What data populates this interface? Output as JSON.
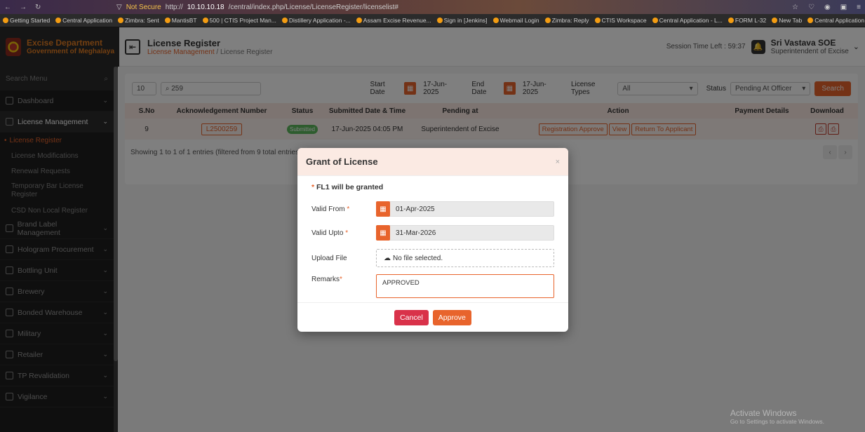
{
  "browser": {
    "not_secure": "Not Secure",
    "url_prefix": "http://",
    "url_host": "10.10.10.18",
    "url_path": "/central/index.php/License/LicenseRegister/licenselist#",
    "bookmarks": [
      "Getting Started",
      "Central Application",
      "Zimbra: Sent",
      "MantisBT",
      "500 | CTIS Project Man...",
      "Distillery Application -...",
      "Assam Excise Revenue...",
      "Sign in [Jenkins]",
      "Webmail Login",
      "Zimbra: Reply",
      "CTIS Workspace",
      "Central Application - L...",
      "FORM L-32",
      "New Tab",
      "Central Application -..."
    ]
  },
  "header": {
    "dept": "Excise Department",
    "gov": "Government of Meghalaya",
    "page_title": "License Register",
    "crumb_parent": "License Management",
    "crumb_sep": " / ",
    "crumb_current": "License Register",
    "session": "Session Time Left : 59:37",
    "user_name": "Sri Vastava SOE",
    "user_role": "Superintendent of Excise"
  },
  "sidebar": {
    "search_placeholder": "Search Menu",
    "items": [
      {
        "label": "Dashboard"
      },
      {
        "label": "License Management"
      },
      {
        "label": "Brand Label Management"
      },
      {
        "label": "Hologram Procurement"
      },
      {
        "label": "Bottling Unit"
      },
      {
        "label": "Brewery"
      },
      {
        "label": "Bonded Warehouse"
      },
      {
        "label": "Military"
      },
      {
        "label": "Retailer"
      },
      {
        "label": "TP Revalidation"
      },
      {
        "label": "Vigilance"
      }
    ],
    "sub": [
      "License Register",
      "License Modifications",
      "Renewal Requests",
      "Temporary Bar License Register",
      "CSD Non Local Register"
    ]
  },
  "filters": {
    "page_size": "10",
    "search_value": "259",
    "start_label": "Start Date",
    "start_value": "17-Jun-2025",
    "end_label": "End Date",
    "end_value": "17-Jun-2025",
    "types_label": "License Types",
    "types_value": "All",
    "status_label": "Status",
    "status_value": "Pending At Officer",
    "search_btn": "Search"
  },
  "table": {
    "headers": [
      "S.No",
      "Acknowledgement Number",
      "Status",
      "Submitted Date & Time",
      "Pending at",
      "Action",
      "Payment Details",
      "Download"
    ],
    "rows": [
      {
        "sno": "9",
        "ack": "L2500259",
        "status": "Submitted",
        "submitted": "17-Jun-2025 04:05 PM",
        "pending": "Superintendent of Excise",
        "actions": [
          "Registration Approve",
          "View",
          "Return To Applicant"
        ]
      }
    ],
    "footer": "Showing 1 to 1 of 1 entries (filtered from 9 total entries)"
  },
  "modal": {
    "title": "Grant of License",
    "grant_text": "FL1 will be granted",
    "valid_from_label": "Valid From",
    "valid_from_value": "01-Apr-2025",
    "valid_upto_label": "Valid Upto",
    "valid_upto_value": "31-Mar-2026",
    "upload_label": "Upload File",
    "upload_value": "No file selected.",
    "remarks_label": "Remarks",
    "remarks_value": "APPROVED",
    "cancel": "Cancel",
    "approve": "Approve"
  },
  "watermark": {
    "line1": "Activate Windows",
    "line2": "Go to Settings to activate Windows."
  },
  "colors": {
    "accent": "#e8642c",
    "danger": "#d9324a",
    "sidebar": "#1f1f1f"
  }
}
